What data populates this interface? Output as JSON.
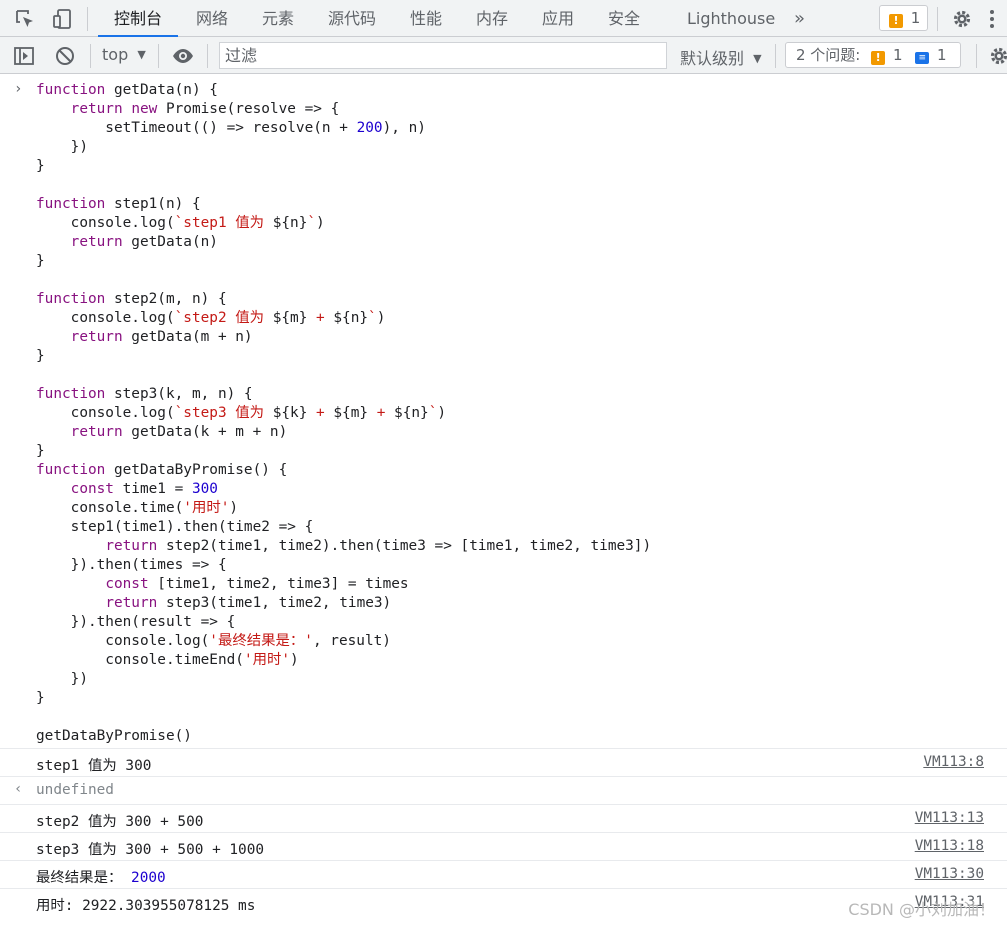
{
  "tabs": {
    "console": "控制台",
    "elements_network": "网络",
    "elements": "元素",
    "sources": "源代码",
    "performance": "性能",
    "memory": "内存",
    "application": "应用",
    "security": "安全",
    "lighthouse": "Lighthouse",
    "more": "»"
  },
  "header_badge": {
    "warning_count": "1"
  },
  "toolbar": {
    "context": "top",
    "filter_placeholder": "过滤",
    "levels": "默认级别",
    "issues_label": "2 个问题:",
    "issues_warn": "1",
    "issues_info": "1"
  },
  "code_lines": [
    "function getData(n) {",
    "    return new Promise(resolve => {",
    "        setTimeout(() => resolve(n + 200), n)",
    "    })",
    "}",
    "",
    "function step1(n) {",
    "    console.log(`step1 值为 ${n}`)",
    "    return getData(n)",
    "}",
    "",
    "function step2(m, n) {",
    "    console.log(`step2 值为 ${m} + ${n}`)",
    "    return getData(m + n)",
    "}",
    "",
    "function step3(k, m, n) {",
    "    console.log(`step3 值为 ${k} + ${m} + ${n}`)",
    "    return getData(k + m + n)",
    "}",
    "function getDataByPromise() {",
    "    const time1 = 300",
    "    console.time('用时')",
    "    step1(time1).then(time2 => {",
    "        return step2(time1, time2).then(time3 => [time1, time2, time3])",
    "    }).then(times => {",
    "        const [time1, time2, time3] = times",
    "        return step3(time1, time2, time3)",
    "    }).then(result => {",
    "        console.log('最终结果是：', result)",
    "        console.timeEnd('用时')",
    "    })",
    "}",
    "",
    "getDataByPromise()"
  ],
  "output": [
    {
      "text": "step1 值为 300",
      "source": "VM113:8"
    },
    {
      "text": "undefined",
      "source": ""
    },
    {
      "text": "step2 值为 300 + 500",
      "source": "VM113:13"
    },
    {
      "text": "step3 值为 300 + 500 + 1000",
      "source": "VM113:18"
    },
    {
      "text": "最终结果是：",
      "value": "2000",
      "source": "VM113:30"
    },
    {
      "text": "用时: 2922.303955078125 ms",
      "source": "VM113:31"
    }
  ],
  "watermark": "CSDN @小刘加油！"
}
